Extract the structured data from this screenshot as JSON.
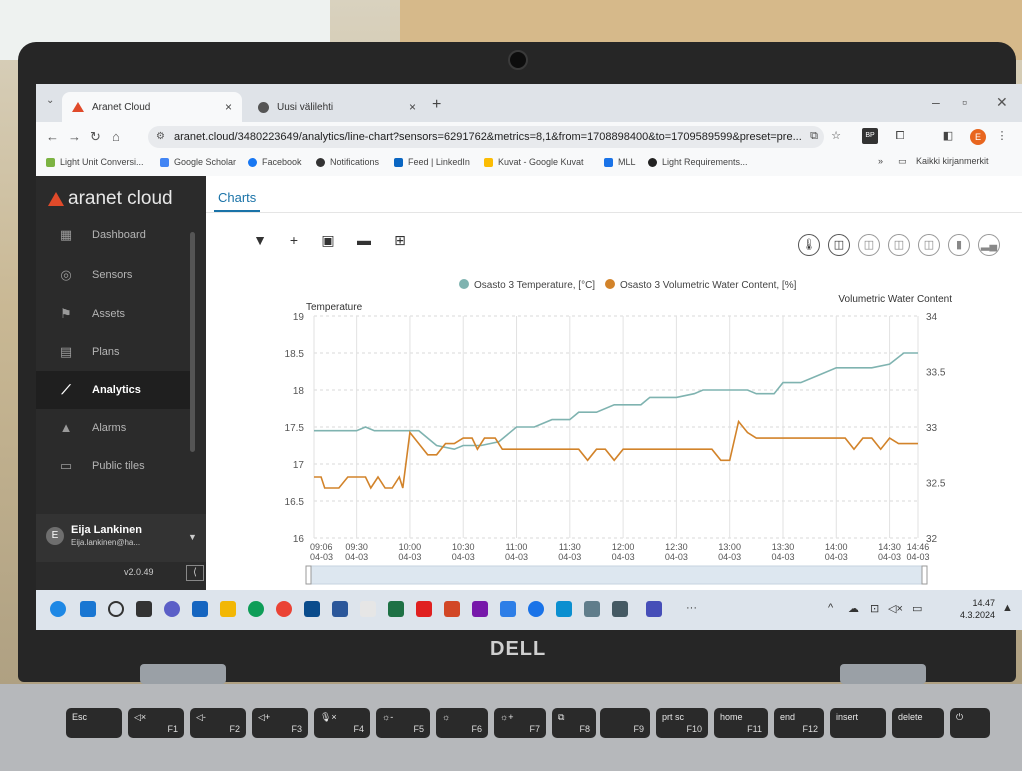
{
  "browser": {
    "tabs": [
      {
        "title": "Aranet Cloud",
        "active": true
      },
      {
        "title": "Uusi välilehti",
        "active": false
      }
    ],
    "url": "aranet.cloud/3480223649/analytics/line-chart?sensors=6291762&metrics=8,1&from=1708898400&to=1709589599&preset=pre...",
    "profile_initial": "E",
    "bookmarks": [
      {
        "label": "Light Unit Conversi...",
        "color": "#7cb342"
      },
      {
        "label": "Google Scholar",
        "color": "#4285f4"
      },
      {
        "label": "Facebook",
        "color": "#1877f2"
      },
      {
        "label": "Notifications",
        "color": "#333333"
      },
      {
        "label": "Feed | LinkedIn",
        "color": "#0a66c2"
      },
      {
        "label": "Kuvat - Google Kuvat",
        "color": "#fbbc04"
      },
      {
        "label": "MLL",
        "color": "#1a73e8"
      },
      {
        "label": "Light Requirements...",
        "color": "#222222"
      }
    ],
    "bookmarks_more": "»",
    "all_bookmarks": "Kaikki kirjanmerkit"
  },
  "app": {
    "brand": "aranet cloud",
    "nav": [
      {
        "label": "Dashboard",
        "icon": "dashboard-icon",
        "glyph": "▦"
      },
      {
        "label": "Sensors",
        "icon": "sensors-icon",
        "glyph": "◎"
      },
      {
        "label": "Assets",
        "icon": "assets-icon",
        "glyph": "⚑"
      },
      {
        "label": "Plans",
        "icon": "plans-icon",
        "glyph": "▤"
      },
      {
        "label": "Analytics",
        "icon": "analytics-icon",
        "glyph": "⟋"
      },
      {
        "label": "Alarms",
        "icon": "alarms-icon",
        "glyph": "▲"
      },
      {
        "label": "Public tiles",
        "icon": "public-tiles-icon",
        "glyph": "▭"
      }
    ],
    "active_nav": "Analytics",
    "user": {
      "name": "Eija Lankinen",
      "email": "Eija.lankinen@ha...",
      "initial": "E"
    },
    "version": "v2.0.49",
    "main_tab": "Charts",
    "toolbar_icons": [
      "filter-icon",
      "add-icon",
      "calendar-icon",
      "card-icon",
      "export-icon"
    ],
    "metric_buttons": [
      "thermometer-icon",
      "water-content-icon",
      "soil-icon",
      "pore-icon",
      "bulk-icon",
      "battery-icon",
      "signal-icon"
    ]
  },
  "chart_data": {
    "type": "line",
    "legend_position": "top-center",
    "y_left_label": "Temperature",
    "y_right_label": "Volumetric Water Content",
    "y_left_ticks": [
      "16",
      "16.5",
      "17",
      "17.5",
      "18",
      "18.5",
      "19"
    ],
    "y_right_ticks": [
      "32",
      "32.5",
      "33",
      "33.5",
      "34"
    ],
    "y_left_range": [
      16,
      19
    ],
    "y_right_range": [
      32,
      34
    ],
    "x_ticks": [
      {
        "time": "09:06",
        "date": "04-03"
      },
      {
        "time": "09:30",
        "date": "04-03"
      },
      {
        "time": "10:00",
        "date": "04-03"
      },
      {
        "time": "10:30",
        "date": "04-03"
      },
      {
        "time": "11:00",
        "date": "04-03"
      },
      {
        "time": "11:30",
        "date": "04-03"
      },
      {
        "time": "12:00",
        "date": "04-03"
      },
      {
        "time": "12:30",
        "date": "04-03"
      },
      {
        "time": "13:00",
        "date": "04-03"
      },
      {
        "time": "13:30",
        "date": "04-03"
      },
      {
        "time": "14:00",
        "date": "04-03"
      },
      {
        "time": "14:30",
        "date": "04-03"
      },
      {
        "time": "14:46",
        "date": "04-03"
      }
    ],
    "x_range": [
      "09:06",
      "14:46"
    ],
    "grid": true,
    "series": [
      {
        "name": "Osasto 3 Temperature, [°C]",
        "axis": "left",
        "color": "#7fb3b0",
        "points": [
          [
            "09:06",
            17.45
          ],
          [
            "09:30",
            17.45
          ],
          [
            "09:35",
            17.5
          ],
          [
            "09:40",
            17.45
          ],
          [
            "10:00",
            17.45
          ],
          [
            "10:05",
            17.45
          ],
          [
            "10:15",
            17.25
          ],
          [
            "10:25",
            17.2
          ],
          [
            "10:30",
            17.25
          ],
          [
            "10:40",
            17.25
          ],
          [
            "10:50",
            17.3
          ],
          [
            "11:00",
            17.5
          ],
          [
            "11:10",
            17.5
          ],
          [
            "11:20",
            17.6
          ],
          [
            "11:30",
            17.6
          ],
          [
            "11:35",
            17.7
          ],
          [
            "11:45",
            17.7
          ],
          [
            "11:55",
            17.8
          ],
          [
            "12:10",
            17.8
          ],
          [
            "12:15",
            17.9
          ],
          [
            "12:30",
            17.9
          ],
          [
            "12:40",
            17.95
          ],
          [
            "12:45",
            18.0
          ],
          [
            "13:00",
            18.0
          ],
          [
            "13:10",
            18.0
          ],
          [
            "13:15",
            17.95
          ],
          [
            "13:25",
            17.95
          ],
          [
            "13:30",
            18.1
          ],
          [
            "13:40",
            18.1
          ],
          [
            "13:50",
            18.2
          ],
          [
            "14:00",
            18.3
          ],
          [
            "14:20",
            18.3
          ],
          [
            "14:30",
            18.35
          ],
          [
            "14:38",
            18.5
          ],
          [
            "14:46",
            18.5
          ]
        ]
      },
      {
        "name": "Osasto 3 Volumetric Water Content, [%]",
        "axis": "right",
        "color": "#d2832a",
        "points": [
          [
            "09:06",
            32.55
          ],
          [
            "09:10",
            32.55
          ],
          [
            "09:12",
            32.45
          ],
          [
            "09:20",
            32.45
          ],
          [
            "09:25",
            32.55
          ],
          [
            "09:35",
            32.55
          ],
          [
            "09:38",
            32.45
          ],
          [
            "09:42",
            32.55
          ],
          [
            "09:46",
            32.45
          ],
          [
            "09:50",
            32.45
          ],
          [
            "09:54",
            32.55
          ],
          [
            "09:56",
            32.45
          ],
          [
            "10:00",
            32.95
          ],
          [
            "10:05",
            32.85
          ],
          [
            "10:10",
            32.75
          ],
          [
            "10:15",
            32.75
          ],
          [
            "10:20",
            32.85
          ],
          [
            "10:25",
            32.85
          ],
          [
            "10:30",
            32.9
          ],
          [
            "10:35",
            32.9
          ],
          [
            "10:38",
            32.8
          ],
          [
            "10:42",
            32.9
          ],
          [
            "10:48",
            32.9
          ],
          [
            "10:52",
            32.8
          ],
          [
            "11:00",
            32.8
          ],
          [
            "11:30",
            32.8
          ],
          [
            "11:35",
            32.8
          ],
          [
            "11:40",
            32.7
          ],
          [
            "11:45",
            32.8
          ],
          [
            "11:50",
            32.8
          ],
          [
            "11:55",
            32.7
          ],
          [
            "12:00",
            32.8
          ],
          [
            "12:50",
            32.8
          ],
          [
            "12:55",
            32.7
          ],
          [
            "13:00",
            32.7
          ],
          [
            "13:05",
            33.05
          ],
          [
            "13:10",
            32.95
          ],
          [
            "13:15",
            32.9
          ],
          [
            "13:30",
            32.9
          ],
          [
            "13:50",
            32.9
          ],
          [
            "14:05",
            32.9
          ],
          [
            "14:10",
            32.8
          ],
          [
            "14:15",
            32.9
          ],
          [
            "14:20",
            32.9
          ],
          [
            "14:25",
            32.8
          ],
          [
            "14:30",
            32.9
          ],
          [
            "14:35",
            32.85
          ],
          [
            "14:46",
            32.85
          ]
        ]
      }
    ]
  },
  "taskbar": {
    "clock_time": "14.47",
    "clock_date": "4.3.2024",
    "overflow": "···",
    "chevron": "^"
  },
  "device": {
    "brand": "DELL"
  },
  "keyboard": {
    "keys": [
      {
        "label": "Esc",
        "sub": ""
      },
      {
        "label": "◁×",
        "sub": "F1"
      },
      {
        "label": "◁-",
        "sub": "F2"
      },
      {
        "label": "◁+",
        "sub": "F3"
      },
      {
        "label": "🎙×",
        "sub": "F4"
      },
      {
        "label": "☼-",
        "sub": "F5"
      },
      {
        "label": "☼",
        "sub": "F6"
      },
      {
        "label": "☼+",
        "sub": "F7"
      },
      {
        "label": "⧉",
        "sub": "F8"
      },
      {
        "label": "",
        "sub": "F9"
      },
      {
        "label": "prt sc",
        "sub": "F10"
      },
      {
        "label": "home",
        "sub": "F11"
      },
      {
        "label": "end",
        "sub": "F12"
      },
      {
        "label": "insert",
        "sub": ""
      },
      {
        "label": "delete",
        "sub": ""
      },
      {
        "label": "⏻",
        "sub": ""
      }
    ]
  }
}
